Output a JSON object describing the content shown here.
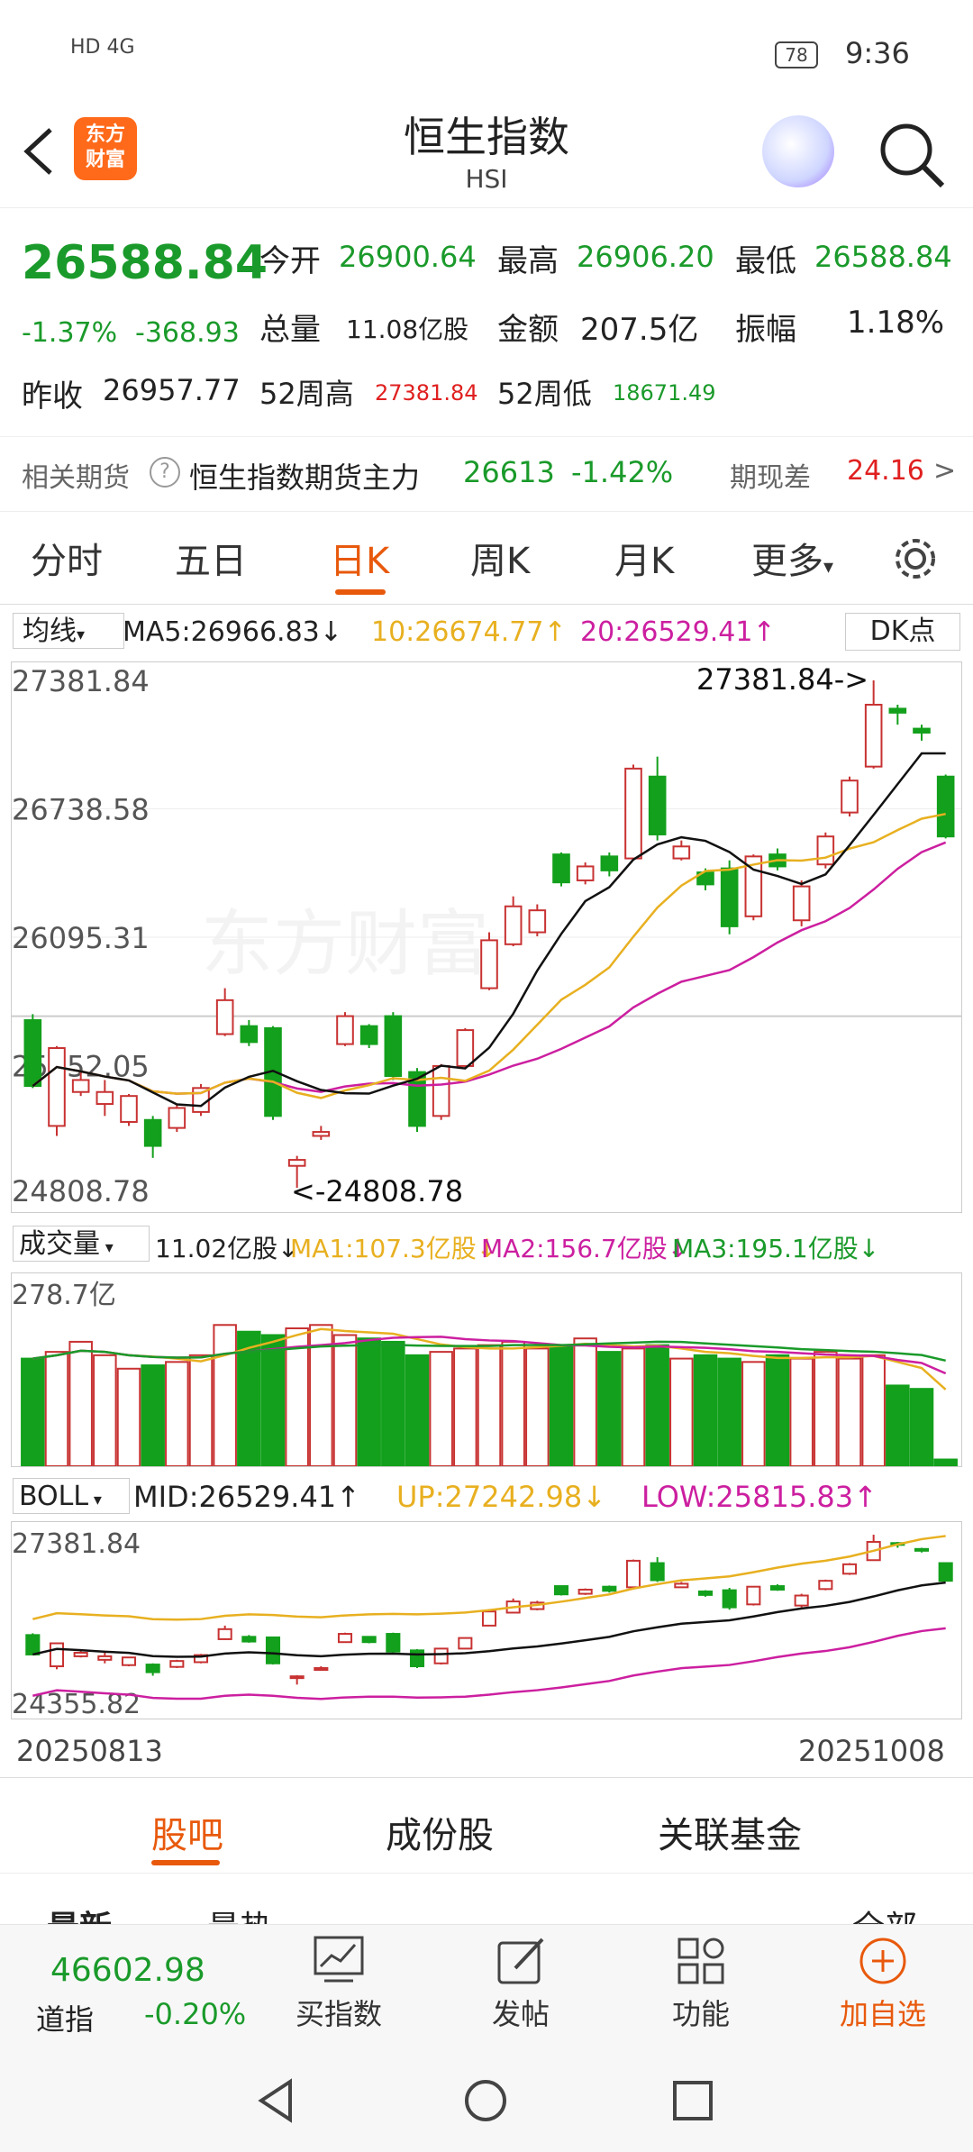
{
  "status": {
    "left": "HD 4G",
    "battery": "78",
    "time": "9:36"
  },
  "header": {
    "logo_line1": "东方",
    "logo_line2": "财富",
    "title": "恒生指数",
    "subtitle": "HSI"
  },
  "quote": {
    "price": "26588.84",
    "pct": "-1.37%",
    "chg": "-368.93",
    "open_label": "今开",
    "open": "26900.64",
    "high_label": "最高",
    "high": "26906.20",
    "low_label": "最低",
    "low": "26588.84",
    "vol_label": "总量",
    "vol": "11.08亿股",
    "amt_label": "金额",
    "amt": "207.5亿",
    "amp_label": "振幅",
    "amp": "1.18%",
    "prev_label": "昨收",
    "prev": "26957.77",
    "w52h_label": "52周高",
    "w52h": "27381.84",
    "w52l_label": "52周低",
    "w52l": "18671.49"
  },
  "futures": {
    "label": "相关期货",
    "name": "恒生指数期货主力",
    "price": "26613",
    "pct": "-1.42%",
    "basis_label": "期现差",
    "basis": "24.16",
    "arrow": ">"
  },
  "tabs": [
    "分时",
    "五日",
    "日K",
    "周K",
    "月K",
    "更多"
  ],
  "active_tab": 2,
  "ma_bar": {
    "select": "均线",
    "ma5": "MA5:26966.83",
    "ma10": "10:26674.77",
    "ma20": "20:26529.41",
    "dk": "DK点"
  },
  "kline_axis": [
    "27381.84",
    "26738.58",
    "26095.31",
    "25452.05",
    "24808.78"
  ],
  "kline_annot": {
    "high": "27381.84->",
    "low": "<-24808.78"
  },
  "vol_bar": {
    "select": "成交量",
    "v": "11.02亿股",
    "ma1": "MA1:107.3亿股",
    "ma2": "MA2:156.7亿股",
    "ma3": "MA3:195.1亿股",
    "axis": "278.7亿"
  },
  "boll_bar": {
    "select": "BOLL",
    "mid": "MID:26529.41",
    "up": "UP:27242.98",
    "low": "LOW:25815.83",
    "axis_top": "27381.84",
    "axis_bot": "24355.82"
  },
  "dates": {
    "start": "20250813",
    "end": "20251008"
  },
  "sub_tabs": [
    "股吧",
    "成份股",
    "关联基金"
  ],
  "peek": {
    "left": "最新",
    "mid": "最热",
    "right": "全部"
  },
  "bottom": {
    "idx_value": "46602.98",
    "idx_name": "道指",
    "idx_pct": "-0.20%",
    "nav": [
      "买指数",
      "发帖",
      "功能",
      "加自选"
    ]
  },
  "watermark": "东方财富",
  "chart_data": {
    "type": "candlestick",
    "ylim": [
      24808.78,
      27381.84
    ],
    "candles": [
      [
        25680,
        25350,
        25710,
        25340
      ],
      [
        25150,
        25540,
        25550,
        25100
      ],
      [
        25320,
        25380,
        25420,
        25300
      ],
      [
        25260,
        25320,
        25380,
        25200
      ],
      [
        25170,
        25300,
        25310,
        25150
      ],
      [
        25180,
        25050,
        25200,
        24990
      ],
      [
        25140,
        25240,
        25260,
        25120
      ],
      [
        25220,
        25340,
        25360,
        25200
      ],
      [
        25610,
        25780,
        25840,
        25600
      ],
      [
        25650,
        25570,
        25680,
        25550
      ],
      [
        25640,
        25200,
        25650,
        25180
      ],
      [
        24950,
        24980,
        25000,
        24840
      ],
      [
        25100,
        25120,
        25150,
        25080
      ],
      [
        25560,
        25700,
        25720,
        25550
      ],
      [
        25650,
        25560,
        25660,
        25540
      ],
      [
        25700,
        25400,
        25720,
        25380
      ],
      [
        25420,
        25150,
        25440,
        25120
      ],
      [
        25200,
        25450,
        25460,
        25180
      ],
      [
        25450,
        25630,
        25640,
        25440
      ],
      [
        25840,
        26080,
        26120,
        25830
      ],
      [
        26060,
        26250,
        26300,
        26050
      ],
      [
        26120,
        26230,
        26260,
        26100
      ],
      [
        26510,
        26370,
        26520,
        26350
      ],
      [
        26380,
        26450,
        26470,
        26360
      ],
      [
        26500,
        26430,
        26520,
        26400
      ],
      [
        26490,
        26940,
        26960,
        26480
      ],
      [
        26900,
        26610,
        27000,
        26580
      ],
      [
        26490,
        26550,
        26580,
        26480
      ],
      [
        26420,
        26360,
        26440,
        26330
      ],
      [
        26440,
        26150,
        26480,
        26110
      ],
      [
        26200,
        26500,
        26510,
        26180
      ],
      [
        26510,
        26450,
        26540,
        26430
      ],
      [
        26180,
        26350,
        26380,
        26150
      ],
      [
        26460,
        26600,
        26620,
        26440
      ],
      [
        26720,
        26880,
        26900,
        26700
      ],
      [
        26950,
        27260,
        27381.84,
        26940
      ],
      [
        27240,
        27220,
        27260,
        27160
      ],
      [
        27140,
        27120,
        27160,
        27080
      ],
      [
        26900,
        26600,
        26910,
        26590
      ]
    ],
    "ma5_last": 26966.83,
    "ma10_last": 26674.77,
    "ma20_last": 26529.41,
    "volume_unit": "亿股",
    "volume_ylim": [
      0,
      278.7
    ],
    "boll": {
      "mid": 26529.41,
      "up": 27242.98,
      "low": 25815.83,
      "ylim": [
        24355.82,
        27381.84
      ]
    }
  }
}
